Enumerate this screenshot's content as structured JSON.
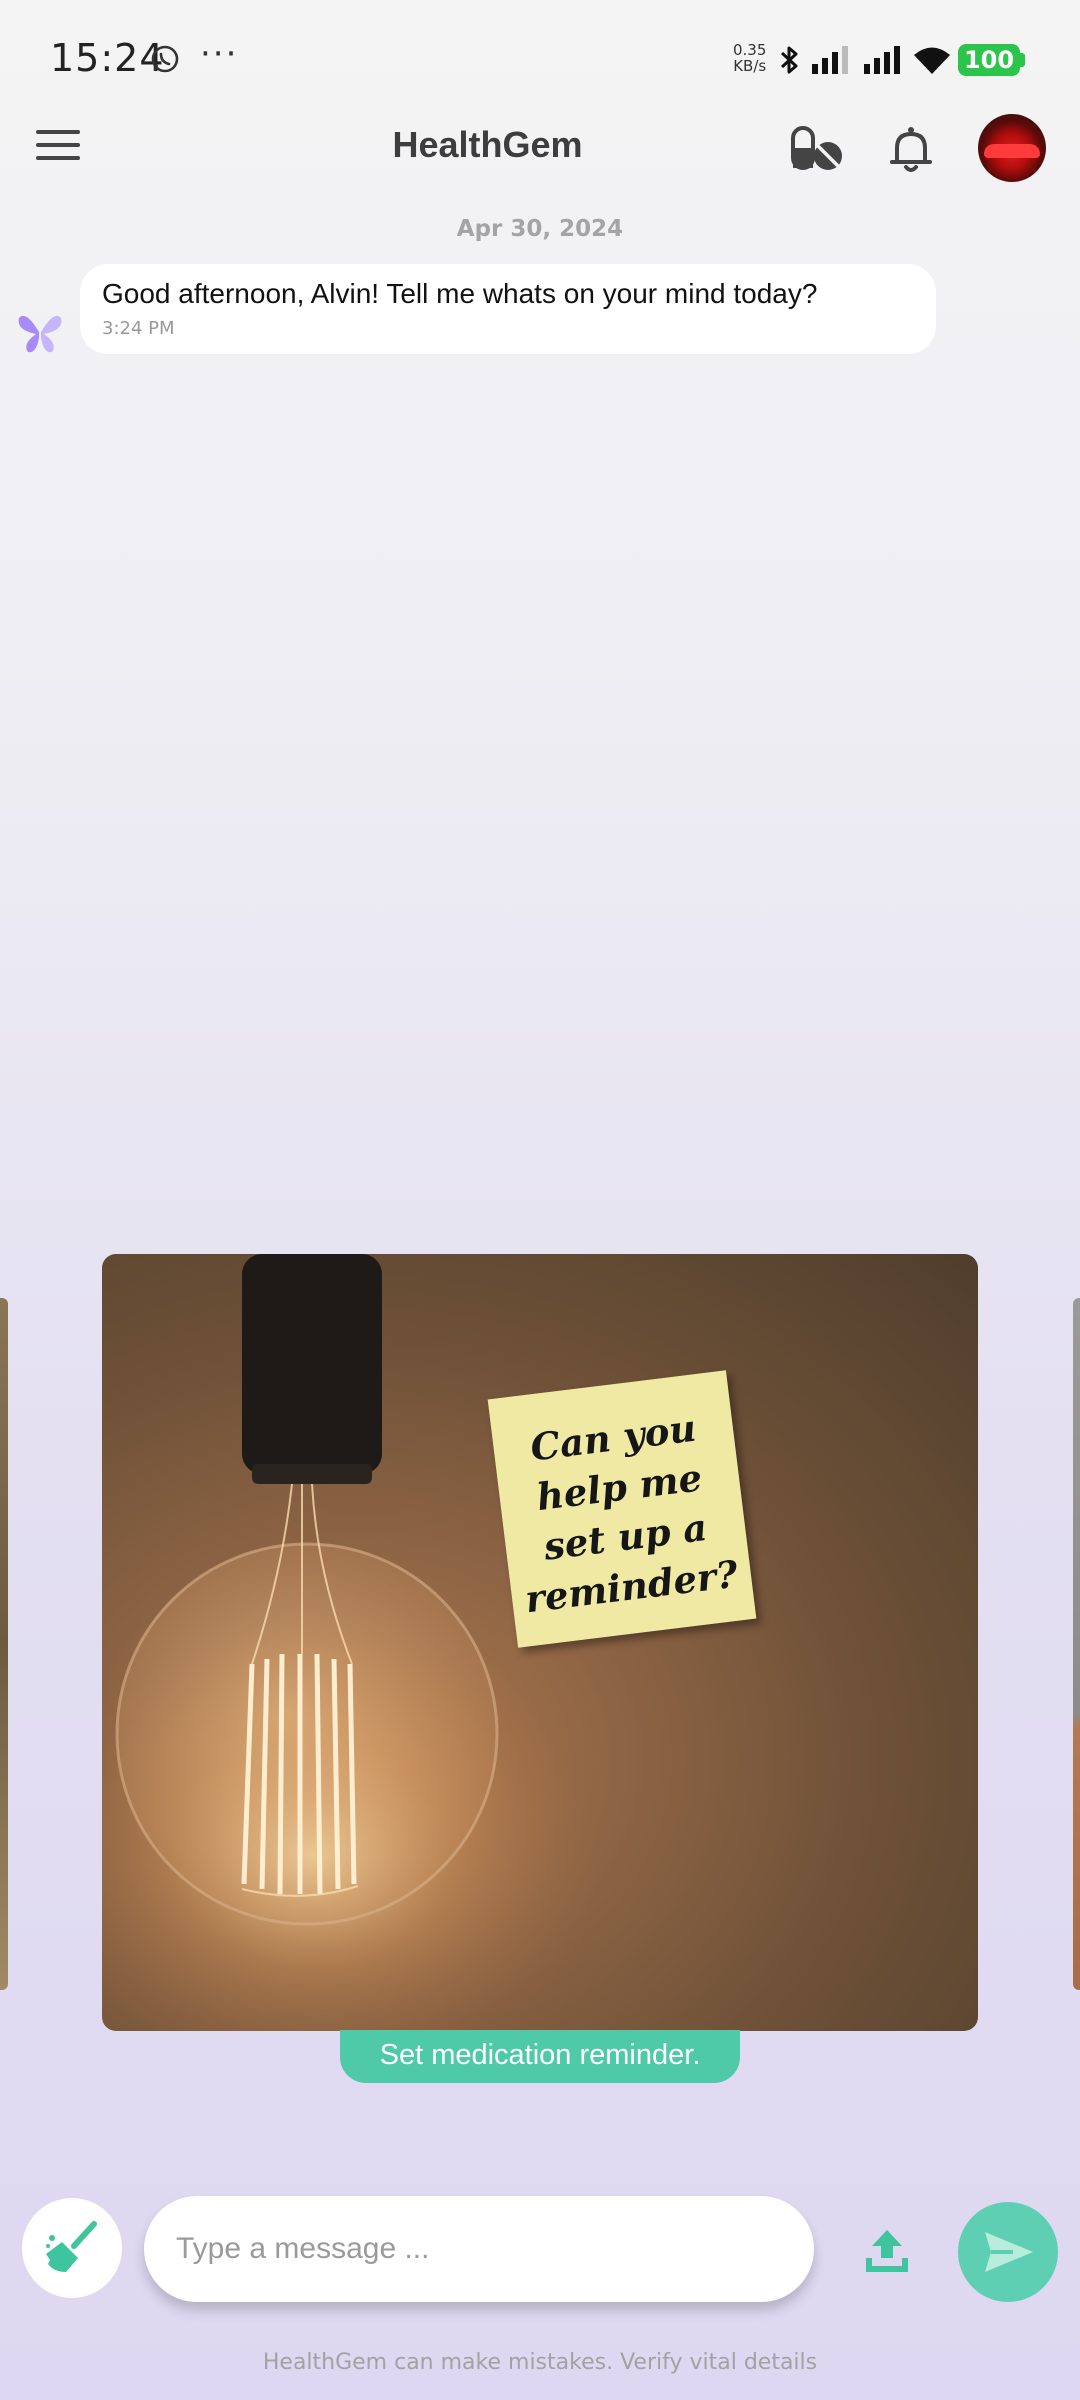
{
  "status_bar": {
    "time": "15:24",
    "more": "···",
    "speed_value": "0.35",
    "speed_unit": "KB/s",
    "battery": "100"
  },
  "header": {
    "title": "HealthGem",
    "icons": [
      "menu-icon",
      "pill-icon",
      "bell-icon",
      "avatar"
    ]
  },
  "chat": {
    "date": "Apr 30, 2024",
    "messages": [
      {
        "sender": "bot",
        "text": "Good afternoon, Alvin! Tell me whats on your mind today?",
        "time": "3:24 PM"
      }
    ]
  },
  "suggestion_card": {
    "note_text": "Can you help me set up a reminder?",
    "chip_label": "Set medication reminder."
  },
  "composer": {
    "placeholder": "Type a message ...",
    "value": ""
  },
  "footer": {
    "disclaimer": "HealthGem can make mistakes. Verify vital details"
  },
  "colors": {
    "accent": "#4ecaa8",
    "send": "#5fcfb3",
    "battery": "#2bc54b",
    "bot_icon": "#a78bfa"
  }
}
